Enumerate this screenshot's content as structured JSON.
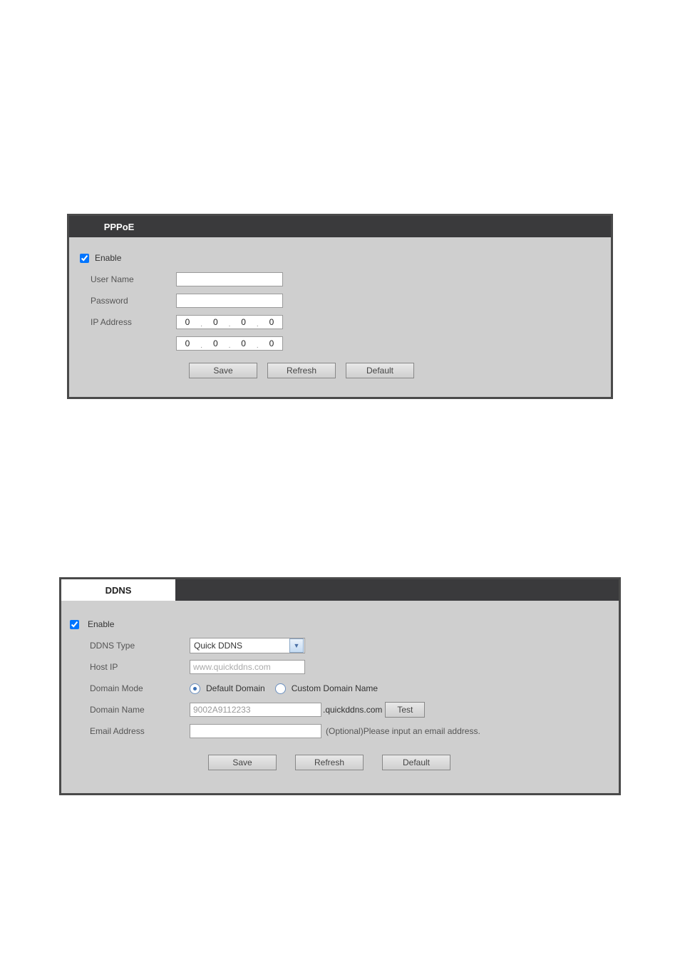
{
  "pppoe": {
    "title": "PPPoE",
    "enable_label": "Enable",
    "enable_checked": true,
    "username_label": "User Name",
    "username_value": "",
    "password_label": "Password",
    "password_value": "",
    "ip_label": "IP Address",
    "ip1": {
      "a": "0",
      "b": "0",
      "c": "0",
      "d": "0"
    },
    "ip2": {
      "a": "0",
      "b": "0",
      "c": "0",
      "d": "0"
    },
    "buttons": {
      "save": "Save",
      "refresh": "Refresh",
      "default": "Default"
    }
  },
  "ddns": {
    "title": "DDNS",
    "enable_label": "Enable",
    "enable_checked": true,
    "type_label": "DDNS Type",
    "type_value": "Quick DDNS",
    "hostip_label": "Host IP",
    "hostip_value": "www.quickddns.com",
    "mode_label": "Domain Mode",
    "mode_default": "Default Domain",
    "mode_custom": "Custom Domain Name",
    "mode_selected": "default",
    "domain_label": "Domain Name",
    "domain_value": "9002A9112233",
    "domain_suffix": ".quickddns.com",
    "test_button": "Test",
    "email_label": "Email Address",
    "email_value": "",
    "email_hint": "(Optional)Please input an email address.",
    "buttons": {
      "save": "Save",
      "refresh": "Refresh",
      "default": "Default"
    }
  }
}
